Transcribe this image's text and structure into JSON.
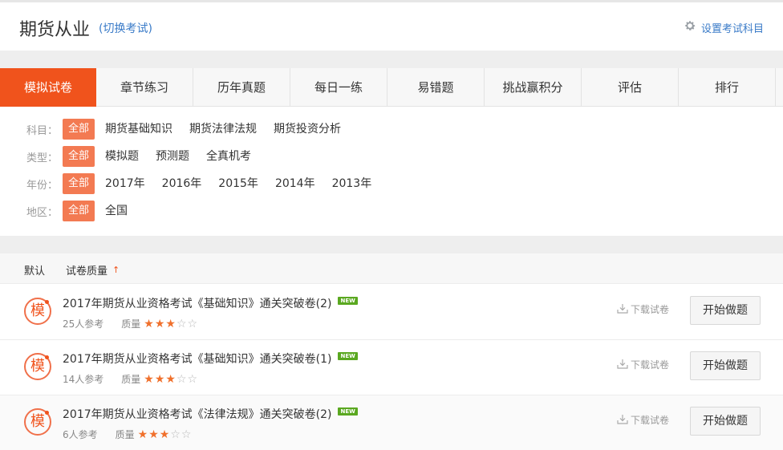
{
  "header": {
    "title": "期货从业",
    "switch_label": "(切换考试)",
    "settings_label": "设置考试科目"
  },
  "tabs": [
    {
      "label": "模拟试卷",
      "active": true
    },
    {
      "label": "章节练习"
    },
    {
      "label": "历年真题"
    },
    {
      "label": "每日一练"
    },
    {
      "label": "易错题"
    },
    {
      "label": "挑战赢积分"
    },
    {
      "label": "评估"
    },
    {
      "label": "排行"
    }
  ],
  "filters": {
    "subject": {
      "label": "科目：",
      "options": [
        "全部",
        "期货基础知识",
        "期货法律法规",
        "期货投资分析"
      ]
    },
    "type": {
      "label": "类型：",
      "options": [
        "全部",
        "模拟题",
        "预测题",
        "全真机考"
      ]
    },
    "year": {
      "label": "年份：",
      "options": [
        "全部",
        "2017年",
        "2016年",
        "2015年",
        "2014年",
        "2013年"
      ]
    },
    "region": {
      "label": "地区：",
      "options": [
        "全部",
        "全国"
      ]
    }
  },
  "sort": {
    "default_label": "默认",
    "quality_label": "试卷质量",
    "arrow": "↑"
  },
  "papers": [
    {
      "badge": "模",
      "title": "2017年期货从业资格考试《基础知识》通关突破卷(2)",
      "new_tag": "NEW",
      "participants": "25人参考",
      "quality_label": "质量",
      "stars": 3,
      "max_stars": 5,
      "download": "下载试卷",
      "start": "开始做题"
    },
    {
      "badge": "模",
      "title": "2017年期货从业资格考试《基础知识》通关突破卷(1)",
      "new_tag": "NEW",
      "participants": "14人参考",
      "quality_label": "质量",
      "stars": 3,
      "max_stars": 5,
      "download": "下载试卷",
      "start": "开始做题"
    },
    {
      "badge": "模",
      "title": "2017年期货从业资格考试《法律法规》通关突破卷(2)",
      "new_tag": "NEW",
      "participants": "6人参考",
      "quality_label": "质量",
      "stars": 3,
      "max_stars": 5,
      "download": "下载试卷",
      "start": "开始做题"
    }
  ],
  "colors": {
    "accent": "#f0531c",
    "selected_filter": "#f37a52",
    "link": "#3a7bc8",
    "new_tag": "#5aa820",
    "star_on": "#f0702c"
  }
}
